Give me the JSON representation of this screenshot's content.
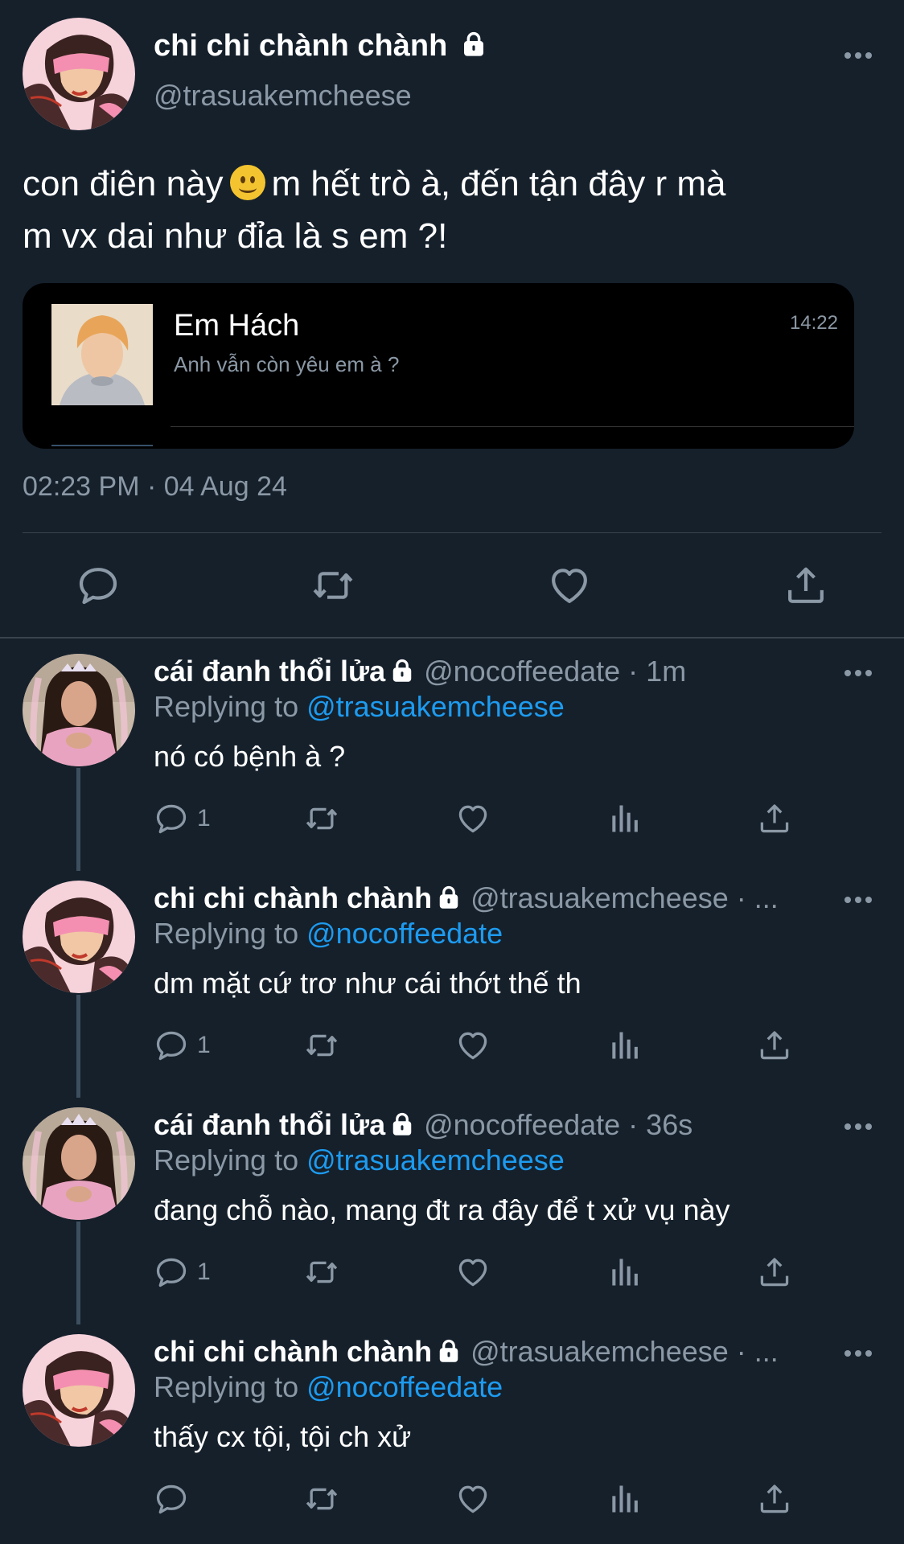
{
  "main_tweet": {
    "author_name": "chi chi chành chành",
    "handle": "@trasuakemcheese",
    "text_part1": "con điên này",
    "text_part2": "m hết trò à, đến tận đây r mà\nm vx dai như đỉa là s em ?!",
    "media": {
      "contact_name": "Em Hách",
      "message": "Anh vẫn còn yêu em à ?",
      "time": "14:22"
    },
    "timestamp": "02:23 PM · 04 Aug 24",
    "icons": [
      "reply-icon",
      "retweet-icon",
      "like-icon",
      "share-icon"
    ]
  },
  "replies": [
    {
      "name": "cái đanh thổi lửa",
      "meta": "@nocoffeedate · 1m",
      "replying_prefix": "Replying to ",
      "replying_to": "@trasuakemcheese",
      "text": "nó có bệnh à ?",
      "reply_count": "1",
      "avatar": "girl"
    },
    {
      "name": "chi chi chành chành",
      "meta": "@trasuakemcheese · ...",
      "replying_prefix": "Replying to ",
      "replying_to": "@nocoffeedate",
      "text": "dm mặt cứ trơ như cái thớt thế th",
      "reply_count": "1",
      "avatar": "cartoon"
    },
    {
      "name": "cái đanh thổi lửa",
      "meta": "@nocoffeedate · 36s",
      "replying_prefix": "Replying to ",
      "replying_to": "@trasuakemcheese",
      "text": "đang chỗ nào, mang đt ra đây để t xử vụ này",
      "reply_count": "1",
      "avatar": "girl"
    },
    {
      "name": "chi chi chành chành",
      "meta": "@trasuakemcheese · ...",
      "replying_prefix": "Replying to ",
      "replying_to": "@nocoffeedate",
      "text": "thấy cx tội, tội ch xử",
      "reply_count": "",
      "avatar": "cartoon"
    }
  ],
  "colors": {
    "background": "#15202b",
    "text_secondary": "#8b98a5",
    "mention": "#1d9bf0",
    "divider": "#38444d"
  }
}
